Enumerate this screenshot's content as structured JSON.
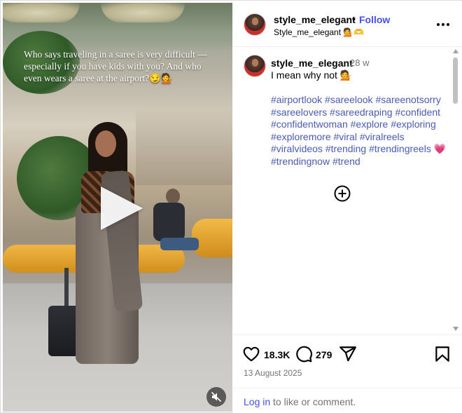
{
  "video": {
    "overlay_text": "Who says traveling in a saree is very difficult —especially if you have kids with you? And who even wears a saree at the airport?😏💁",
    "play_icon": "play-icon",
    "mute_icon": "muted-speaker-icon"
  },
  "header": {
    "username": "style_me_elegant",
    "separator": "•",
    "follow_label": "Follow",
    "subtitle": "Style_me_elegant 💁🫶",
    "more_icon": "more-horizontal-icon"
  },
  "post": {
    "username": "style_me_elegant",
    "time_ago": "28 w",
    "caption": "I mean why not 💁",
    "hashtags": [
      "#airportlook",
      "#sareelook",
      "#sareenotsorry",
      "#sareelovers",
      "#sareedraping",
      "#confident",
      "#confidentwoman",
      "#explore",
      "#exploring",
      "#exploremore",
      "#viral",
      "#viralreels",
      "#viralvideos",
      "#trending",
      "#trendingreels"
    ],
    "heart_emoji": "💗",
    "hashtags_after_heart": [
      "#trendingnow",
      "#trend"
    ],
    "load_more_icon": "plus-circle-icon"
  },
  "actions": {
    "likes": "18.3K",
    "comments": "279",
    "date": "13 August 2025",
    "like_icon": "heart-icon",
    "comment_icon": "comment-icon",
    "share_icon": "share-icon",
    "save_icon": "bookmark-icon"
  },
  "login_prompt": {
    "link_label": "Log in",
    "rest": " to like or comment."
  }
}
